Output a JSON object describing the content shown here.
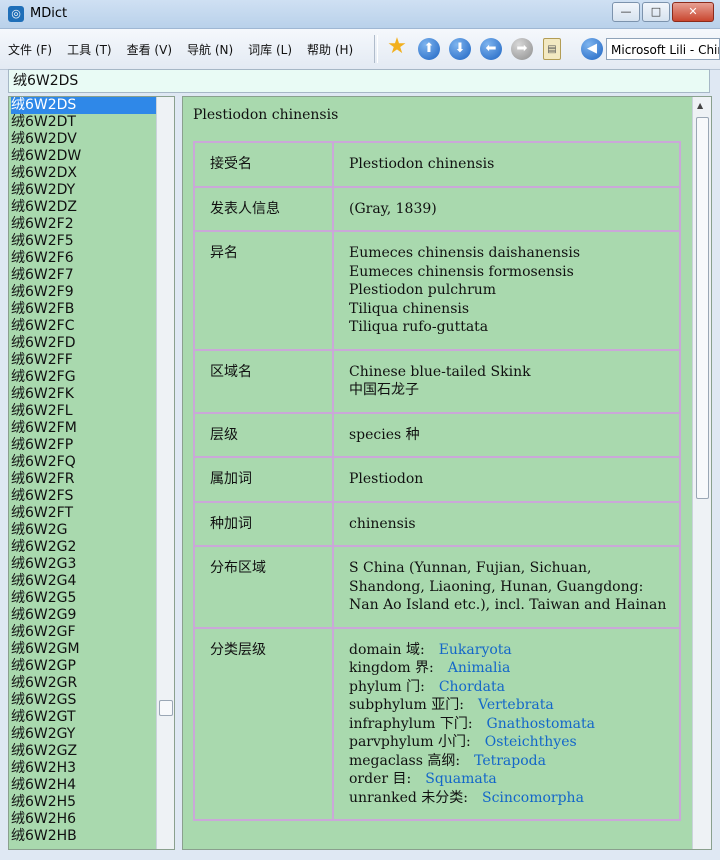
{
  "window": {
    "title": "MDict",
    "icon": "dictionary-app-icon",
    "controls": [
      "minimize-icon",
      "maximize-icon",
      "close-icon"
    ]
  },
  "menu": [
    {
      "label": "文件 (F)"
    },
    {
      "label": "工具 (T)"
    },
    {
      "label": "查看 (V)"
    },
    {
      "label": "导航 (N)"
    },
    {
      "label": "词库 (L)"
    },
    {
      "label": "帮助 (H)"
    }
  ],
  "toolbar": {
    "voice": "Microsoft Lili - Chinese"
  },
  "search": {
    "value": "绒6W2DS"
  },
  "word_list": [
    "绒6W2DS",
    "绒6W2DT",
    "绒6W2DV",
    "绒6W2DW",
    "绒6W2DX",
    "绒6W2DY",
    "绒6W2DZ",
    "绒6W2F2",
    "绒6W2F5",
    "绒6W2F6",
    "绒6W2F7",
    "绒6W2F9",
    "绒6W2FB",
    "绒6W2FC",
    "绒6W2FD",
    "绒6W2FF",
    "绒6W2FG",
    "绒6W2FK",
    "绒6W2FL",
    "绒6W2FM",
    "绒6W2FP",
    "绒6W2FQ",
    "绒6W2FR",
    "绒6W2FS",
    "绒6W2FT",
    "绒6W2G",
    "绒6W2G2",
    "绒6W2G3",
    "绒6W2G4",
    "绒6W2G5",
    "绒6W2G9",
    "绒6W2GF",
    "绒6W2GM",
    "绒6W2GP",
    "绒6W2GR",
    "绒6W2GS",
    "绒6W2GT",
    "绒6W2GY",
    "绒6W2GZ",
    "绒6W2H3",
    "绒6W2H4",
    "绒6W2H5",
    "绒6W2H6",
    "绒6W2HB"
  ],
  "entry": {
    "headword": "Plestiodon chinensis",
    "accepted_label": "接受名",
    "accepted_value": "Plestiodon chinensis",
    "author_label": "发表人信息",
    "author_value": "(Gray, 1839)",
    "synonym_label": "异名",
    "synonyms": [
      "Eumeces chinensis daishanensis",
      "Eumeces chinensis formosensis",
      "Plestiodon pulchrum",
      "Tiliqua chinensis",
      "Tiliqua rufo-guttata"
    ],
    "common_label": "区域名",
    "common_en": "Chinese blue-tailed Skink",
    "common_zh": "中国石龙子",
    "rank_label": "层级",
    "rank_value": "species 种",
    "genus_label": "属加词",
    "genus_value": "Plestiodon",
    "species_label": "种加词",
    "species_value": "chinensis",
    "dist_label": "分布区域",
    "dist_value": "S China (Yunnan, Fujian, Sichuan, Shandong, Liaoning, Hunan, Guangdong: Nan Ao Island etc.), incl. Taiwan and Hainan",
    "taxon_label": "分类层级",
    "taxonomy": [
      {
        "rank": "domain 域:",
        "name": "Eukaryota"
      },
      {
        "rank": "kingdom 界:",
        "name": "Animalia"
      },
      {
        "rank": "phylum 门:",
        "name": "Chordata"
      },
      {
        "rank": "subphylum 亚门:",
        "name": "Vertebrata"
      },
      {
        "rank": "infraphylum 下门:",
        "name": "Gnathostomata"
      },
      {
        "rank": "parvphylum 小门:",
        "name": "Osteichthyes"
      },
      {
        "rank": "megaclass 高纲:",
        "name": "Tetrapoda"
      },
      {
        "rank": "order 目:",
        "name": "Squamata"
      },
      {
        "rank": "unranked 未分类:",
        "name": "Scincomorpha"
      }
    ]
  }
}
